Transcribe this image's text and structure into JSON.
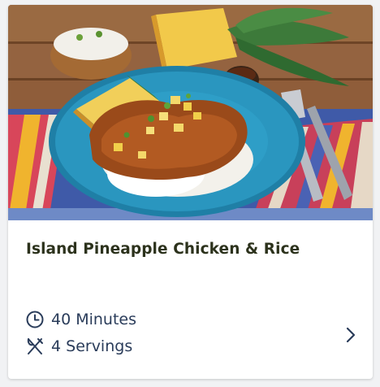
{
  "recipe": {
    "title": "Island Pineapple Chicken & Rice",
    "time_label": "40 Minutes",
    "servings_label": "4 Servings"
  },
  "icons": {
    "time": "clock-icon",
    "servings": "utensils-icon",
    "open": "chevron-right-icon"
  },
  "colors": {
    "title": "#2c321c",
    "meta_text": "#2a3c5a",
    "card_background": "#ffffff",
    "page_background": "#f1f2f4"
  }
}
